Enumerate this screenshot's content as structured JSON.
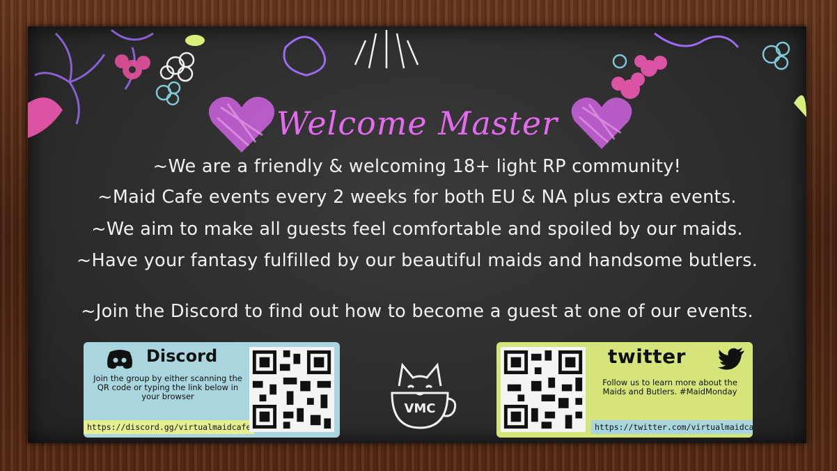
{
  "title": "Welcome Master",
  "lines": [
    "~We are a friendly & welcoming 18+ light RP community!",
    "~Maid Cafe events every 2 weeks for both EU & NA plus extra events.",
    "~We aim to make all guests feel comfortable and spoiled by our maids.",
    "~Have your fantasy fulfilled by our beautiful maids and handsome butlers.",
    "~Join the Discord to find out how to become a guest at one of our events."
  ],
  "discord": {
    "name": "Discord",
    "text": "Join the group by either scanning the QR code or typing the link below in your browser",
    "link": "https://discord.gg/virtualmaidcafe",
    "color": "#a9d6de"
  },
  "twitter": {
    "name": "twitter",
    "text": "Follow us to learn more about the Maids and Butlers. #MaidMonday",
    "link": "https://twitter.com/virtualmaidcafe",
    "color": "#d6e57a"
  },
  "logo": {
    "text": "VMC"
  },
  "colors": {
    "title": "#e46bf0",
    "board": "#2c2c2c",
    "frame": "#5a2d16"
  }
}
